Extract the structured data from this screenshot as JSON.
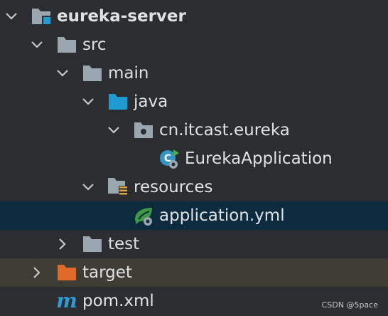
{
  "tree": {
    "root": {
      "label": "eureka-server",
      "icon": "module-folder-icon"
    },
    "src": {
      "label": "src",
      "icon": "folder-icon"
    },
    "main": {
      "label": "main",
      "icon": "folder-icon"
    },
    "java": {
      "label": "java",
      "icon": "source-root-folder-icon"
    },
    "package": {
      "label": "cn.itcast.eureka",
      "icon": "package-icon"
    },
    "app_class": {
      "label": "EurekaApplication",
      "icon": "spring-boot-class-icon"
    },
    "resources": {
      "label": "resources",
      "icon": "resources-root-icon"
    },
    "app_yml": {
      "label": "application.yml",
      "icon": "spring-yml-icon"
    },
    "test": {
      "label": "test",
      "icon": "folder-icon"
    },
    "target": {
      "label": "target",
      "icon": "excluded-folder-icon"
    },
    "pom": {
      "label": "pom.xml",
      "icon": "maven-icon"
    }
  },
  "watermark": "CSDN @5pace",
  "colors": {
    "background": "#2b2d30",
    "selected_row": "#0d2b3e",
    "excluded_row": "#3f3b35",
    "folder": "#9aa7b0",
    "source_root": "#1e9bd1",
    "excluded": "#e06a2a",
    "spring": "#3c9a45",
    "text": "#dfe1e5"
  }
}
